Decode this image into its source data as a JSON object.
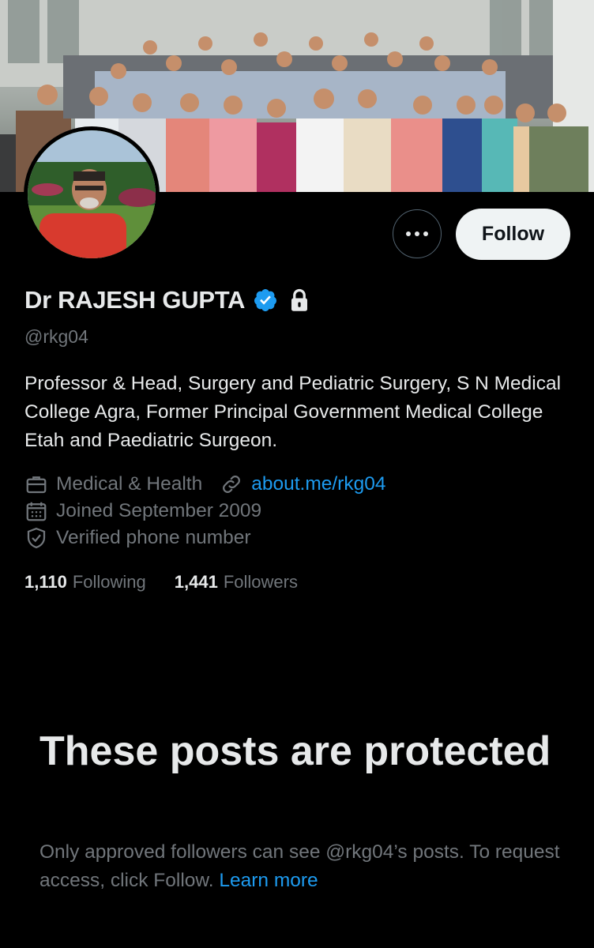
{
  "banner": {
    "alt": "group photo"
  },
  "profile": {
    "name": "Dr RAJESH GUPTA",
    "handle": "@rkg04",
    "bio": "Professor & Head, Surgery and Pediatric Surgery, S N Medical College Agra, Former Principal Government Medical College Etah and Paediatric Surgeon.",
    "category": "Medical & Health",
    "website": "about.me/rkg04",
    "joined": "Joined September 2009",
    "verified_phone": "Verified phone number"
  },
  "actions": {
    "more_icon": "more-horizontal-icon",
    "follow_label": "Follow"
  },
  "stats": {
    "following_count": "1,110",
    "following_label": "Following",
    "followers_count": "1,441",
    "followers_label": "Followers"
  },
  "protected": {
    "title": "These posts are protected",
    "message": "Only approved followers can see @rkg04’s posts. To request access, click Follow.",
    "learn_more": "Learn more"
  },
  "colors": {
    "accent": "#1d9bf0",
    "background": "#000000",
    "muted": "#71767b"
  }
}
